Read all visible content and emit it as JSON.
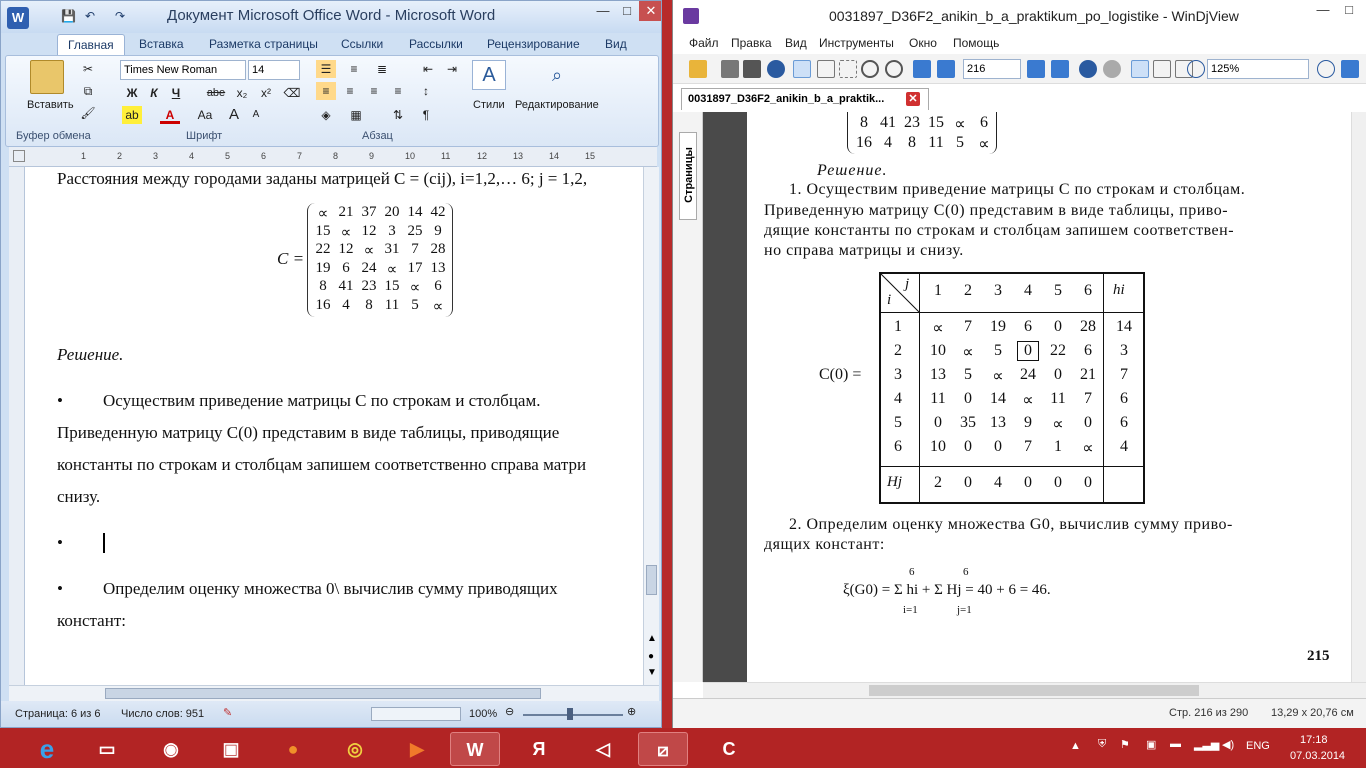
{
  "word": {
    "icon_label": "W",
    "qat": [
      "💾",
      "↶",
      "↷"
    ],
    "title": "Документ Microsoft Office Word - Microsoft Word",
    "window_controls": [
      "—",
      "□",
      "✕"
    ],
    "tabs": [
      "Главная",
      "Вставка",
      "Разметка страницы",
      "Ссылки",
      "Рассылки",
      "Рецензирование",
      "Вид"
    ],
    "ribbon": {
      "paste_label": "Вставить",
      "clipboard_group": "Буфер обмена",
      "font_name": "Times New Roman",
      "font_size": "14",
      "font_group": "Шрифт",
      "paragraph_group": "Абзац",
      "styles_label": "Стили",
      "editing_label": "Редактирование",
      "bold": "Ж",
      "italic": "К",
      "underline": "Ч",
      "strike": "abe",
      "subscript": "x₂",
      "superscript": "x²",
      "case": "Aa",
      "grow": "A",
      "shrink": "A"
    },
    "ruler_numbers": [
      "1",
      "2",
      "3",
      "4",
      "5",
      "6",
      "7",
      "8",
      "9",
      "10",
      "11",
      "12",
      "13",
      "14",
      "15"
    ],
    "doc": {
      "line1": "Расстояния между городами заданы матрицей C = (cij), i=1,2,… 6; j = 1,2,",
      "matrix_label": "C =",
      "matrix": [
        [
          "∝",
          "21",
          "37",
          "20",
          "14",
          "42"
        ],
        [
          "15",
          "∝",
          "12",
          "3",
          "25",
          "9"
        ],
        [
          "22",
          "12",
          "∝",
          "31",
          "7",
          "28"
        ],
        [
          "19",
          "6",
          "24",
          "∝",
          "17",
          "13"
        ],
        [
          "8",
          "41",
          "23",
          "15",
          "∝",
          "6"
        ],
        [
          "16",
          "4",
          "8",
          "11",
          "5",
          "∝"
        ]
      ],
      "solution": "Решение.",
      "bullet": "•",
      "p1a": "Осуществим приведение матрицы C по строкам и столбцам.",
      "p1b": "Приведенную матрицу C(0) представим в виде таблицы, приводящие",
      "p1c": "константы по строкам и столбцам запишем соответственно справа матри",
      "p1d": "снизу.",
      "p3a": "Определим оценку множества 0\\ вычислив сумму приводящих",
      "p3b": "констант:"
    },
    "status": {
      "page": "Страница: 6 из 6",
      "words": "Число слов: 951",
      "zoom": "100%"
    }
  },
  "djvu": {
    "title": "0031897_D36F2_anikin_b_a_praktikum_po_logistike - WinDjView",
    "window_controls": [
      "—",
      "□"
    ],
    "menu": [
      "Файл",
      "Правка",
      "Вид",
      "Инструменты",
      "Окно",
      "Помощь"
    ],
    "page_input": "216",
    "zoom_input": "125%",
    "tab_label": "0031897_D36F2_anikin_b_a_praktik...",
    "tab_close": "✕",
    "side_tab": "Страницы",
    "doc": {
      "top_rows": [
        [
          "8",
          "41",
          "23",
          "15",
          "∝",
          "6"
        ],
        [
          "16",
          "4",
          "8",
          "11",
          "5",
          "∝"
        ]
      ],
      "solution": "Решение.",
      "p1": "1. Осуществим приведение матрицы C по строкам и столбцам.",
      "p2": "Приведенную матрицу C(0) представим в виде таблицы, приво-",
      "p3": "дящие константы по строкам и столбцам запишем соответствен-",
      "p4": "но справа матрицы и снизу.",
      "table_label": "C(0) =",
      "col_header_j": "j",
      "row_header_i": "i",
      "cols": [
        "1",
        "2",
        "3",
        "4",
        "5",
        "6"
      ],
      "h_header": "hi",
      "rows": [
        {
          "i": "1",
          "vals": [
            "∝",
            "7",
            "19",
            "6",
            "0",
            "28"
          ],
          "h": "14"
        },
        {
          "i": "2",
          "vals": [
            "10",
            "∝",
            "5",
            "0",
            "22",
            "6"
          ],
          "h": "3"
        },
        {
          "i": "3",
          "vals": [
            "13",
            "5",
            "∝",
            "24",
            "0",
            "21"
          ],
          "h": "7"
        },
        {
          "i": "4",
          "vals": [
            "11",
            "0",
            "14",
            "∝",
            "11",
            "7"
          ],
          "h": "6"
        },
        {
          "i": "5",
          "vals": [
            "0",
            "35",
            "13",
            "9",
            "∝",
            "0"
          ],
          "h": "6"
        },
        {
          "i": "6",
          "vals": [
            "10",
            "0",
            "0",
            "7",
            "1",
            "∝"
          ],
          "h": "4"
        }
      ],
      "H_label": "Hj",
      "H_vals": [
        "2",
        "0",
        "4",
        "0",
        "0",
        "0"
      ],
      "p5": "2. Определим оценку множества G0, вычислив сумму приво-",
      "p6": "дящих констант:",
      "formula": "ξ(G0) = Σ hi + Σ Hj = 40 + 6 = 46.",
      "sum_top": "6",
      "sum_bottom_i": "i=1",
      "sum_bottom_j": "j=1",
      "page_number": "215"
    },
    "status": {
      "page": "Стр. 216 из 290",
      "size": "13,29 x 20,76 см"
    }
  },
  "taskbar": {
    "tray_lang": "ENG",
    "time": "17:18",
    "date": "07.03.2014"
  }
}
